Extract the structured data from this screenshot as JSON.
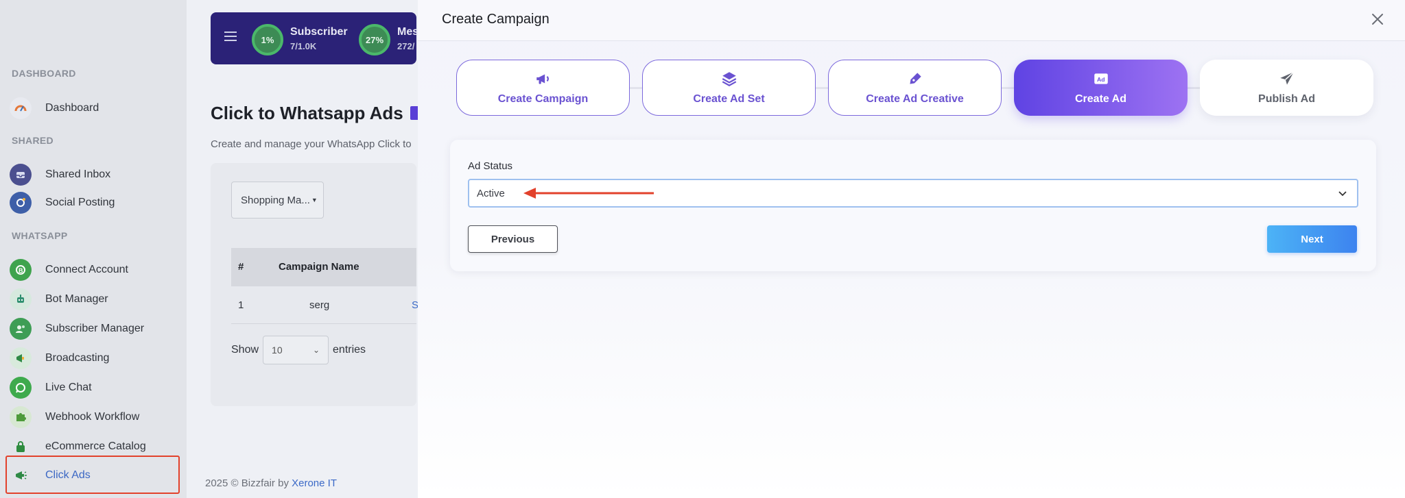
{
  "sidebar": {
    "sections": {
      "dashboard": "DASHBOARD",
      "shared": "SHARED",
      "whatsapp": "WHATSAPP"
    },
    "items": [
      {
        "label": "Dashboard",
        "icon": "speedometer-icon",
        "color": "#e4783a"
      },
      {
        "label": "Shared Inbox",
        "icon": "inbox-icon",
        "color": "#4b4f8f"
      },
      {
        "label": "Social Posting",
        "icon": "share-icon",
        "color": "#3e5fa8"
      },
      {
        "label": "Connect Account",
        "icon": "whatsapp-business-icon",
        "color": "#3fa34d"
      },
      {
        "label": "Bot Manager",
        "icon": "bot-icon",
        "color": "#2e8f6f"
      },
      {
        "label": "Subscriber Manager",
        "icon": "subscribers-icon",
        "color": "#3e9d55"
      },
      {
        "label": "Broadcasting",
        "icon": "megaphone-icon",
        "color": "#2f8a46"
      },
      {
        "label": "Live Chat",
        "icon": "whatsapp-chat-icon",
        "color": "#3eaa4d"
      },
      {
        "label": "Webhook Workflow",
        "icon": "puzzle-icon",
        "color": "#4e9b3a"
      },
      {
        "label": "eCommerce Catalog",
        "icon": "shopping-bag-icon",
        "color": "#2e8c3f"
      },
      {
        "label": "Click Ads",
        "icon": "megaphone-ads-icon",
        "color": "#2f8a46"
      }
    ]
  },
  "topbar": {
    "stats": [
      {
        "percent": "1%",
        "label": "Subscriber",
        "value": "7/1.0K"
      },
      {
        "percent": "27%",
        "label": "Mes",
        "value": "272/"
      }
    ]
  },
  "page": {
    "title": "Click to Whatsapp Ads",
    "subtitle": "Create and manage your WhatsApp Click to",
    "filter_value": "Shopping Ma...",
    "table": {
      "headers": [
        "#",
        "Campaign Name"
      ],
      "rows": [
        {
          "index": "1",
          "name": "serg",
          "extra": "S"
        }
      ]
    },
    "length_menu": {
      "show": "Show",
      "value": "10",
      "entries": "entries"
    }
  },
  "footer": {
    "text": "2025 © Bizzfair by",
    "link": "Xerone IT"
  },
  "modal": {
    "title": "Create Campaign",
    "steps": [
      {
        "label": "Create Campaign",
        "icon": "megaphone-icon",
        "state": "done"
      },
      {
        "label": "Create Ad Set",
        "icon": "layers-icon",
        "state": "done"
      },
      {
        "label": "Create Ad Creative",
        "icon": "pen-icon",
        "state": "done"
      },
      {
        "label": "Create Ad",
        "icon": "ad-icon",
        "state": "active"
      },
      {
        "label": "Publish Ad",
        "icon": "send-icon",
        "state": "pending"
      }
    ],
    "form": {
      "field_label": "Ad Status",
      "field_value": "Active",
      "previous_label": "Previous",
      "next_label": "Next"
    }
  },
  "colors": {
    "accent": "#6a52d1",
    "active_step_start": "#5f43e3",
    "active_step_end": "#9d72f2",
    "next_button": "#3d83ef",
    "annotation_red": "#e2412b"
  }
}
